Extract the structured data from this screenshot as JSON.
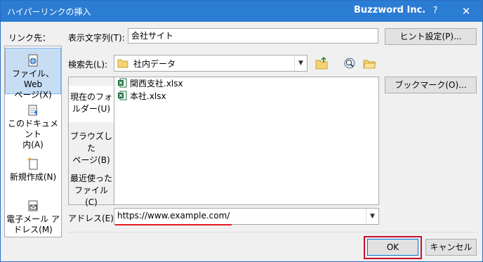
{
  "window": {
    "title": "ハイパーリンクの挿入",
    "company": "Buzzword Inc.",
    "help": "?",
    "close": "✕"
  },
  "link_to": {
    "label": "リンク先：",
    "items": [
      {
        "line1": "ファイル、Web",
        "line2": "ページ(X)",
        "icon": "globe-file-icon",
        "selected": true
      },
      {
        "line1": "このドキュメント",
        "line2": "内(A)",
        "icon": "document-place-icon",
        "selected": false
      },
      {
        "line1": "新規作成(N)",
        "line2": "",
        "icon": "new-document-icon",
        "selected": false
      },
      {
        "line1": "電子メール ア",
        "line2": "ドレス(M)",
        "icon": "email-icon",
        "selected": false
      }
    ]
  },
  "display_text": {
    "label": "表示文字列(T):",
    "value": "会社サイト"
  },
  "screentip_button": "ヒント設定(P)...",
  "look_in": {
    "label": "検索先(L):",
    "value": "社内データ"
  },
  "bookmark_button": "ブックマーク(O)...",
  "inner_tabs": [
    {
      "line1": "現在のフォ",
      "line2": "ルダー(U)",
      "selected": true
    },
    {
      "line1": "ブラウズした",
      "line2": "ページ(B)",
      "selected": false
    },
    {
      "line1": "最近使った",
      "line2": "ファイル(C)",
      "selected": false
    }
  ],
  "files": [
    "関西支社.xlsx",
    "本社.xlsx"
  ],
  "address": {
    "label": "アドレス(E):",
    "value": "https://www.example.com/"
  },
  "ok_button": "OK",
  "cancel_button": "キャンセル",
  "colors": {
    "titlebar": "#2b7cd3",
    "selected": "#c7ddf4",
    "highlight": "#c8102e"
  }
}
